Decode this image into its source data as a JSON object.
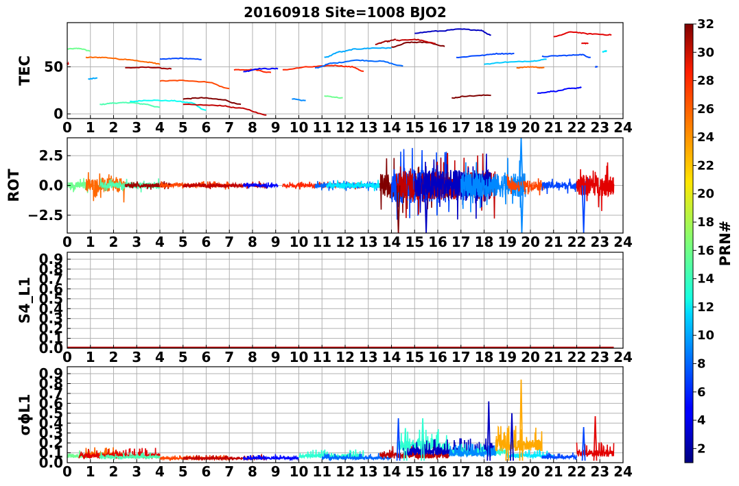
{
  "title": "20160918 Site=1008 BJO2",
  "colorbar": {
    "label": "PRN#",
    "min": 1,
    "max": 32,
    "ticks": [
      2,
      4,
      6,
      8,
      10,
      12,
      14,
      16,
      18,
      20,
      22,
      24,
      26,
      28,
      30,
      32
    ],
    "colormap": "jet"
  },
  "chart_data": [
    {
      "type": "line",
      "ylabel": "TEC",
      "xlim": [
        0,
        24
      ],
      "ylim": [
        -5,
        97
      ],
      "xticks": [
        0,
        1,
        2,
        3,
        4,
        5,
        6,
        7,
        8,
        9,
        10,
        11,
        12,
        13,
        14,
        15,
        16,
        17,
        18,
        19,
        20,
        21,
        22,
        23,
        24
      ],
      "yticks": [
        0,
        50
      ],
      "grid": true,
      "series": [
        {
          "prn": 16,
          "x": [
            0.0,
            0.5,
            1.0
          ],
          "y": [
            69,
            69.5,
            67
          ]
        },
        {
          "prn": 29,
          "x": [
            0.0,
            0.05
          ],
          "y": [
            53,
            53
          ]
        },
        {
          "prn": 25,
          "x": [
            0.8,
            1.5,
            2.5,
            3.5,
            4.0
          ],
          "y": [
            60,
            60,
            58,
            55,
            53
          ]
        },
        {
          "prn": 10,
          "x": [
            0.9,
            1.3
          ],
          "y": [
            37,
            38
          ]
        },
        {
          "prn": 15,
          "x": [
            1.4,
            2.0,
            2.7,
            3.3,
            4.0
          ],
          "y": [
            10,
            11.5,
            12,
            10.5,
            7
          ]
        },
        {
          "prn": 13,
          "x": [
            2.7,
            3.5,
            4.5,
            5.3,
            6.0
          ],
          "y": [
            13,
            14.5,
            14,
            12,
            4
          ]
        },
        {
          "prn": 31,
          "x": [
            2.5,
            3.5,
            4.5
          ],
          "y": [
            49,
            49.5,
            48
          ]
        },
        {
          "prn": 7,
          "x": [
            4.0,
            4.8,
            5.8
          ],
          "y": [
            58,
            59,
            58
          ]
        },
        {
          "prn": 26,
          "x": [
            4.0,
            5.0,
            6.0,
            7.0
          ],
          "y": [
            35,
            35.5,
            34,
            27
          ]
        },
        {
          "prn": 32,
          "x": [
            5.0,
            5.8,
            6.6,
            7.5
          ],
          "y": [
            16,
            17,
            15.5,
            10
          ]
        },
        {
          "prn": 30,
          "x": [
            5.0,
            6.5,
            7.5,
            8.6
          ],
          "y": [
            10,
            9,
            6,
            -1
          ]
        },
        {
          "prn": 27,
          "x": [
            7.2,
            8.0,
            8.8
          ],
          "y": [
            47,
            47,
            44
          ]
        },
        {
          "prn": 5,
          "x": [
            7.6,
            8.3,
            9.1
          ],
          "y": [
            45,
            48,
            48
          ]
        },
        {
          "prn": 9,
          "x": [
            9.7,
            10.3
          ],
          "y": [
            16,
            14
          ]
        },
        {
          "prn": 27,
          "x": [
            9.3,
            10.5,
            11.5,
            12.3,
            12.8
          ],
          "y": [
            47,
            50,
            51.5,
            50,
            45
          ]
        },
        {
          "prn": 8,
          "x": [
            10.7,
            11.5,
            12.5,
            13.5,
            14.5
          ],
          "y": [
            49,
            54,
            57,
            56,
            51
          ]
        },
        {
          "prn": 16,
          "x": [
            11.1,
            11.9
          ],
          "y": [
            19,
            17
          ]
        },
        {
          "prn": 10,
          "x": [
            11.1,
            11.8,
            12.5,
            13.3,
            14.0
          ],
          "y": [
            60,
            66,
            69,
            70,
            70
          ]
        },
        {
          "prn": 31,
          "x": [
            13.3,
            13.8,
            14.2
          ],
          "y": [
            74,
            77,
            79
          ]
        },
        {
          "prn": 32,
          "x": [
            14.0,
            14.8,
            15.5,
            16.3
          ],
          "y": [
            71,
            76,
            76,
            72
          ]
        },
        {
          "prn": 30,
          "x": [
            14.2,
            15.0,
            15.9
          ],
          "y": [
            78,
            79,
            75
          ]
        },
        {
          "prn": 3,
          "x": [
            15.0,
            16.0,
            17.0,
            17.8,
            18.3
          ],
          "y": [
            86,
            88,
            90,
            89,
            84
          ]
        },
        {
          "prn": 7,
          "x": [
            16.8,
            17.8,
            18.6,
            19.3
          ],
          "y": [
            60,
            62,
            64,
            64
          ]
        },
        {
          "prn": 11,
          "x": [
            18.0,
            19.0,
            20.0,
            20.7
          ],
          "y": [
            53,
            55,
            56,
            58
          ]
        },
        {
          "prn": 32,
          "x": [
            16.6,
            17.3,
            18.3
          ],
          "y": [
            17,
            19,
            20
          ]
        },
        {
          "prn": 25,
          "x": [
            19.4,
            20.0,
            20.6
          ],
          "y": [
            49,
            50,
            49
          ]
        },
        {
          "prn": 7,
          "x": [
            20.5,
            21.5,
            22.2,
            22.6
          ],
          "y": [
            61,
            62,
            63,
            60
          ]
        },
        {
          "prn": 5,
          "x": [
            20.3,
            21.0,
            21.8,
            22.2
          ],
          "y": [
            22,
            24,
            27,
            28
          ]
        },
        {
          "prn": 29,
          "x": [
            21.0,
            21.8,
            22.6,
            23.5
          ],
          "y": [
            82,
            87,
            85,
            84
          ]
        },
        {
          "prn": 29,
          "x": [
            22.2,
            22.5
          ],
          "y": [
            75,
            75
          ]
        },
        {
          "prn": 12,
          "x": [
            23.1,
            23.3
          ],
          "y": [
            66,
            67
          ]
        },
        {
          "prn": 7,
          "x": [
            22.8,
            22.9
          ],
          "y": [
            50,
            50
          ]
        }
      ]
    },
    {
      "type": "line",
      "ylabel": "ROT",
      "xlim": [
        0,
        24
      ],
      "ylim": [
        -4,
        4
      ],
      "xticks": [
        0,
        1,
        2,
        3,
        4,
        5,
        6,
        7,
        8,
        9,
        10,
        11,
        12,
        13,
        14,
        15,
        16,
        17,
        18,
        19,
        20,
        21,
        22,
        23,
        24
      ],
      "yticks": [
        -2.5,
        0.0,
        2.5
      ],
      "grid": true,
      "segments": [
        {
          "prn": 16,
          "start": 0.0,
          "end": 1.0,
          "amp": 0.3
        },
        {
          "prn": 25,
          "start": 0.8,
          "end": 2.5,
          "amp": 0.6
        },
        {
          "prn": 15,
          "start": 1.4,
          "end": 4.0,
          "amp": 0.25
        },
        {
          "prn": 31,
          "start": 2.5,
          "end": 4.5,
          "amp": 0.15
        },
        {
          "prn": 26,
          "start": 4.0,
          "end": 7.0,
          "amp": 0.15
        },
        {
          "prn": 30,
          "start": 5.0,
          "end": 8.6,
          "amp": 0.15
        },
        {
          "prn": 5,
          "start": 7.6,
          "end": 9.1,
          "amp": 0.12
        },
        {
          "prn": 27,
          "start": 9.3,
          "end": 12.8,
          "amp": 0.15
        },
        {
          "prn": 8,
          "start": 10.7,
          "end": 13.5,
          "amp": 0.2
        },
        {
          "prn": 12,
          "start": 11.2,
          "end": 13.8,
          "amp": 0.2
        },
        {
          "prn": 32,
          "start": 13.5,
          "end": 16.5,
          "amp": 1.0
        },
        {
          "prn": 7,
          "start": 14.0,
          "end": 16.5,
          "amp": 1.5
        },
        {
          "prn": 30,
          "start": 14.2,
          "end": 18.5,
          "amp": 1.2
        },
        {
          "prn": 3,
          "start": 15.0,
          "end": 18.3,
          "amp": 1.3
        },
        {
          "prn": 9,
          "start": 17.0,
          "end": 19.8,
          "amp": 1.0
        },
        {
          "prn": 26,
          "start": 19.0,
          "end": 20.6,
          "amp": 0.4
        },
        {
          "prn": 7,
          "start": 20.5,
          "end": 22.6,
          "amp": 0.3
        },
        {
          "prn": 29,
          "start": 22.0,
          "end": 23.6,
          "amp": 0.9
        }
      ],
      "spikes": [
        {
          "prn": 9,
          "x": 19.6,
          "y": 4.0
        },
        {
          "prn": 9,
          "x": 19.63,
          "y": -4.0
        },
        {
          "prn": 32,
          "x": 14.3,
          "y": -4.0
        },
        {
          "prn": 3,
          "x": 15.5,
          "y": -4.0
        },
        {
          "prn": 7,
          "x": 22.3,
          "y": -4.0
        }
      ]
    },
    {
      "type": "line",
      "ylabel": "S4_L1",
      "xlim": [
        0,
        24
      ],
      "ylim": [
        0,
        0.97
      ],
      "xticks": [
        0,
        1,
        2,
        3,
        4,
        5,
        6,
        7,
        8,
        9,
        10,
        11,
        12,
        13,
        14,
        15,
        16,
        17,
        18,
        19,
        20,
        21,
        22,
        23,
        24
      ],
      "yticks": [
        0.0,
        0.1,
        0.2,
        0.3,
        0.4,
        0.5,
        0.6,
        0.7,
        0.8,
        0.9
      ],
      "grid": true,
      "baseline": 0.0,
      "baseline_prn": 30
    },
    {
      "type": "line",
      "ylabel": "σϕL1",
      "xlim": [
        0,
        24
      ],
      "ylim": [
        0,
        0.97
      ],
      "xticks": [
        0,
        1,
        2,
        3,
        4,
        5,
        6,
        7,
        8,
        9,
        10,
        11,
        12,
        13,
        14,
        15,
        16,
        17,
        18,
        19,
        20,
        21,
        22,
        23,
        24
      ],
      "yticks": [
        0.0,
        0.1,
        0.2,
        0.3,
        0.4,
        0.5,
        0.6,
        0.7,
        0.8,
        0.9
      ],
      "grid": true,
      "segments": [
        {
          "prn": 16,
          "start": 0.0,
          "end": 1.0,
          "base": 0.06,
          "amp": 0.04
        },
        {
          "prn": 25,
          "start": 0.8,
          "end": 2.5,
          "base": 0.07,
          "amp": 0.05
        },
        {
          "prn": 29,
          "start": 0.5,
          "end": 4.0,
          "base": 0.06,
          "amp": 0.05
        },
        {
          "prn": 15,
          "start": 1.4,
          "end": 4.0,
          "base": 0.05,
          "amp": 0.03
        },
        {
          "prn": 26,
          "start": 4.0,
          "end": 7.0,
          "base": 0.04,
          "amp": 0.02
        },
        {
          "prn": 30,
          "start": 5.0,
          "end": 8.6,
          "base": 0.04,
          "amp": 0.02
        },
        {
          "prn": 5,
          "start": 7.6,
          "end": 10.0,
          "base": 0.04,
          "amp": 0.02
        },
        {
          "prn": 14,
          "start": 10.0,
          "end": 12.8,
          "base": 0.06,
          "amp": 0.04
        },
        {
          "prn": 8,
          "start": 11.0,
          "end": 14.0,
          "base": 0.04,
          "amp": 0.03
        },
        {
          "prn": 14,
          "start": 14.3,
          "end": 16.5,
          "base": 0.15,
          "amp": 0.1
        },
        {
          "prn": 30,
          "start": 13.5,
          "end": 16.5,
          "base": 0.06,
          "amp": 0.06
        },
        {
          "prn": 3,
          "start": 14.5,
          "end": 18.5,
          "base": 0.1,
          "amp": 0.08
        },
        {
          "prn": 14,
          "start": 16.5,
          "end": 19.0,
          "base": 0.09,
          "amp": 0.06
        },
        {
          "prn": 9,
          "start": 16.5,
          "end": 18.5,
          "base": 0.08,
          "amp": 0.06
        },
        {
          "prn": 23,
          "start": 18.5,
          "end": 20.5,
          "base": 0.15,
          "amp": 0.12
        },
        {
          "prn": 12,
          "start": 19.0,
          "end": 21.0,
          "base": 0.06,
          "amp": 0.04
        },
        {
          "prn": 7,
          "start": 20.5,
          "end": 22.0,
          "base": 0.05,
          "amp": 0.03
        },
        {
          "prn": 29,
          "start": 22.0,
          "end": 23.6,
          "base": 0.08,
          "amp": 0.07
        }
      ],
      "spikes": [
        {
          "prn": 7,
          "x": 14.3,
          "y": 0.45
        },
        {
          "prn": 14,
          "x": 14.6,
          "y": 0.35
        },
        {
          "prn": 14,
          "x": 15.35,
          "y": 0.45
        },
        {
          "prn": 3,
          "x": 18.2,
          "y": 0.62
        },
        {
          "prn": 23,
          "x": 19.6,
          "y": 0.84
        },
        {
          "prn": 3,
          "x": 19.2,
          "y": 0.5
        },
        {
          "prn": 23,
          "x": 19.0,
          "y": 0.3
        },
        {
          "prn": 7,
          "x": 22.3,
          "y": 0.36
        },
        {
          "prn": 29,
          "x": 22.8,
          "y": 0.47
        }
      ]
    }
  ]
}
